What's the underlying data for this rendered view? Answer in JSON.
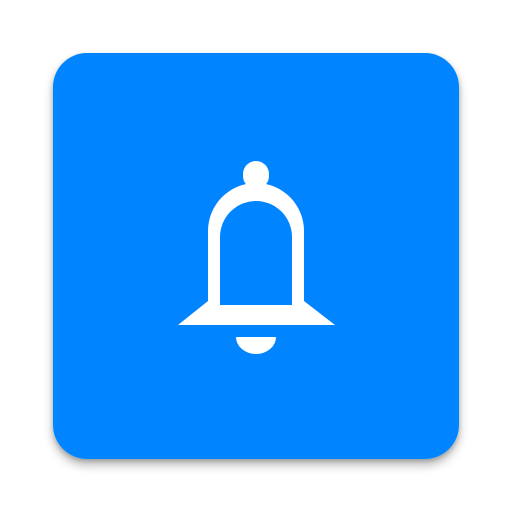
{
  "app_icon": {
    "icon": "bell-icon",
    "background_color": "#0084FF",
    "glyph_color": "#FFFFFF"
  }
}
